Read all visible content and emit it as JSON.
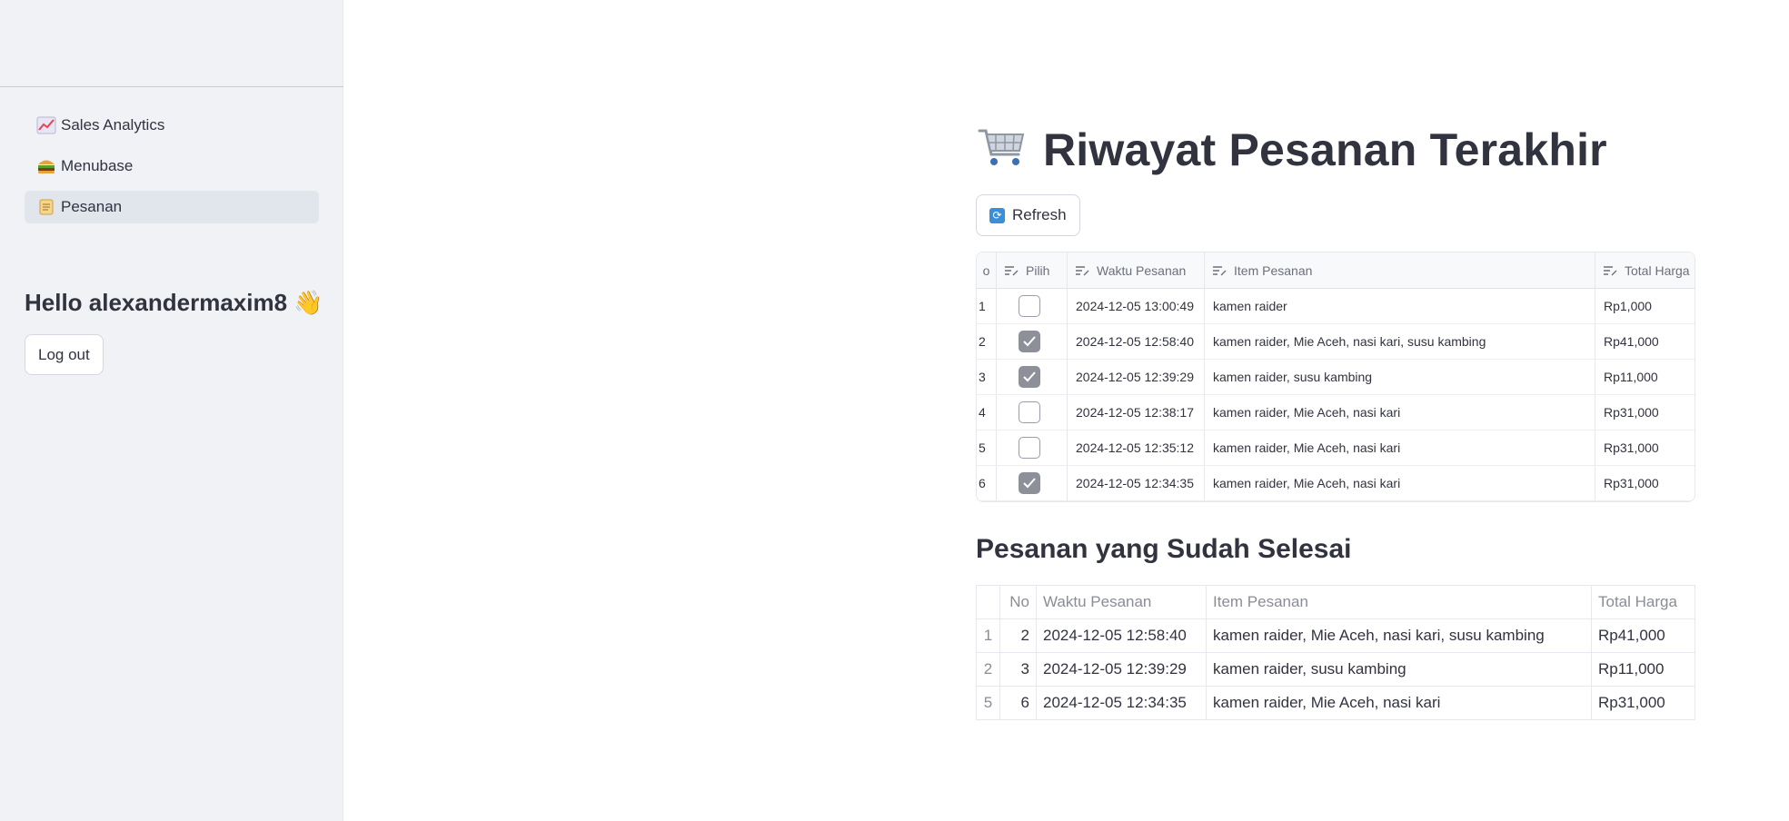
{
  "sidebar": {
    "items": [
      {
        "label": "Sales Analytics",
        "icon": "chart-increasing-icon"
      },
      {
        "label": "Menubase",
        "icon": "burger-icon"
      },
      {
        "label": "Pesanan",
        "icon": "scroll-icon",
        "active": true
      }
    ],
    "greeting": "Hello alexandermaxim8",
    "greeting_icon": "👋",
    "logout_label": "Log out"
  },
  "main": {
    "title": "Riwayat Pesanan Terakhir",
    "title_icon": "🛒",
    "refresh_label": "Refresh",
    "editor": {
      "columns": {
        "no": "o",
        "pilih": "Pilih",
        "waktu": "Waktu Pesanan",
        "item": "Item Pesanan",
        "total": "Total Harga"
      },
      "rows": [
        {
          "no": "1",
          "checked": false,
          "waktu": "2024-12-05 13:00:49",
          "item": "kamen raider",
          "total": "Rp1,000"
        },
        {
          "no": "2",
          "checked": true,
          "waktu": "2024-12-05 12:58:40",
          "item": "kamen raider, Mie Aceh, nasi kari, susu kambing",
          "total": "Rp41,000"
        },
        {
          "no": "3",
          "checked": true,
          "waktu": "2024-12-05 12:39:29",
          "item": "kamen raider, susu kambing",
          "total": "Rp11,000"
        },
        {
          "no": "4",
          "checked": false,
          "waktu": "2024-12-05 12:38:17",
          "item": "kamen raider, Mie Aceh, nasi kari",
          "total": "Rp31,000"
        },
        {
          "no": "5",
          "checked": false,
          "waktu": "2024-12-05 12:35:12",
          "item": "kamen raider, Mie Aceh, nasi kari",
          "total": "Rp31,000"
        },
        {
          "no": "6",
          "checked": true,
          "waktu": "2024-12-05 12:34:35",
          "item": "kamen raider, Mie Aceh, nasi kari",
          "total": "Rp31,000"
        }
      ]
    },
    "done_title": "Pesanan yang Sudah Selesai",
    "done_table": {
      "columns": {
        "no": "No",
        "waktu": "Waktu Pesanan",
        "item": "Item Pesanan",
        "total": "Total Harga"
      },
      "rows": [
        {
          "idx": "1",
          "no": "2",
          "waktu": "2024-12-05 12:58:40",
          "item": "kamen raider, Mie Aceh, nasi kari, susu kambing",
          "total": "Rp41,000"
        },
        {
          "idx": "2",
          "no": "3",
          "waktu": "2024-12-05 12:39:29",
          "item": "kamen raider, susu kambing",
          "total": "Rp11,000"
        },
        {
          "idx": "5",
          "no": "6",
          "waktu": "2024-12-05 12:34:35",
          "item": "kamen raider, Mie Aceh, nasi kari",
          "total": "Rp31,000"
        }
      ]
    }
  }
}
